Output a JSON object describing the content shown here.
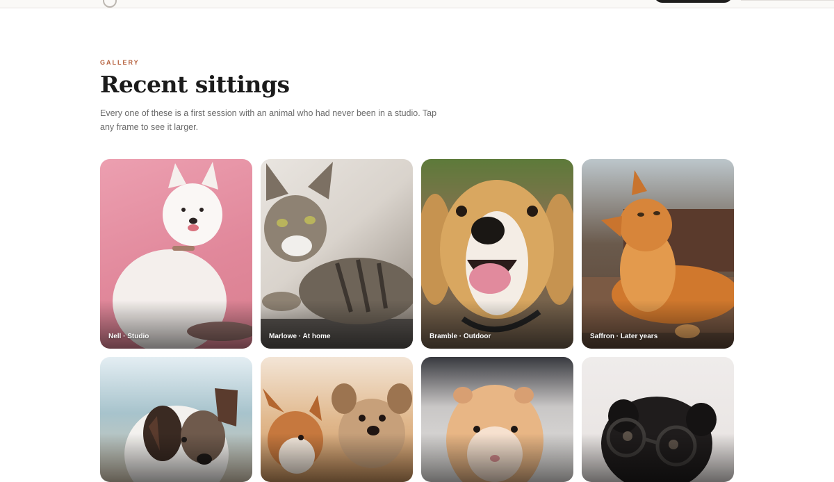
{
  "header": {
    "eyebrow": "GALLERY",
    "title": "Recent sittings",
    "subtitle": "Every one of these is a first session with an animal who had never been in a studio. Tap any frame to see it larger."
  },
  "gallery": [
    {
      "caption": "Nell · Studio",
      "subject": "samoyed-photo"
    },
    {
      "caption": "Marlowe · At home",
      "subject": "tabby-cat-photo"
    },
    {
      "caption": "Bramble · Outdoor",
      "subject": "beagle-photo"
    },
    {
      "caption": "Saffron · Later years",
      "subject": "maine-coon-photo"
    },
    {
      "caption": "",
      "subject": "australian-shepherd-photo"
    },
    {
      "caption": "",
      "subject": "corgi-and-terrier-photo"
    },
    {
      "caption": "",
      "subject": "hamster-photo"
    },
    {
      "caption": "",
      "subject": "pug-with-glasses-photo"
    }
  ],
  "colors": {
    "accent": "#b5603d",
    "title": "#1b1b1b",
    "body_text": "#6b6b6b",
    "dark_button": "#1e1d1c"
  }
}
